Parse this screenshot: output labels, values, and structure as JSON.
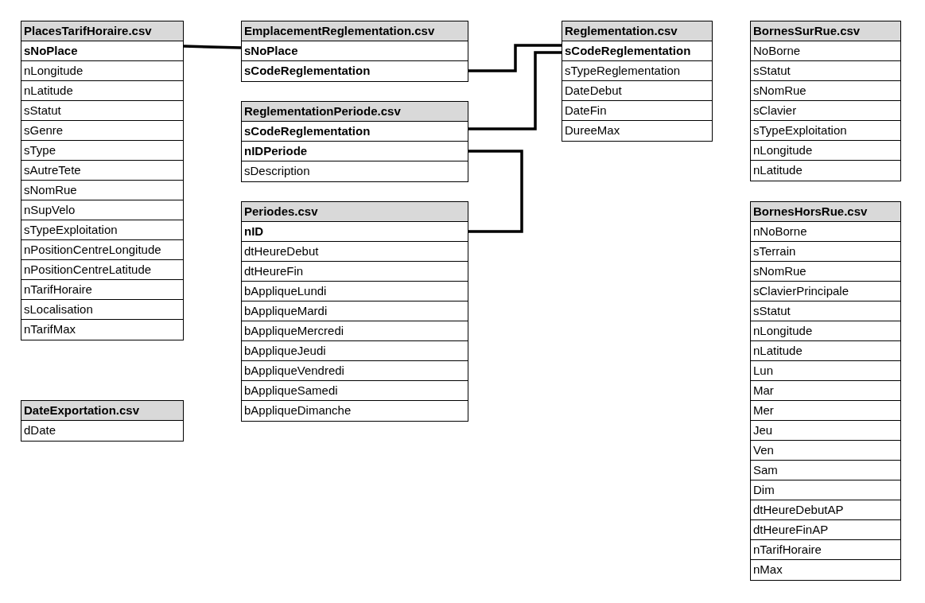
{
  "columns": [
    {
      "tables": [
        {
          "title": "PlacesTarifHoraire.csv",
          "fields": [
            {
              "name": "sNoPlace",
              "key": true
            },
            {
              "name": "nLongitude",
              "key": false
            },
            {
              "name": "nLatitude",
              "key": false
            },
            {
              "name": "sStatut",
              "key": false
            },
            {
              "name": "sGenre",
              "key": false
            },
            {
              "name": "sType",
              "key": false
            },
            {
              "name": "sAutreTete",
              "key": false
            },
            {
              "name": "sNomRue",
              "key": false
            },
            {
              "name": "nSupVelo",
              "key": false
            },
            {
              "name": "sTypeExploitation",
              "key": false
            },
            {
              "name": "nPositionCentreLongitude",
              "key": false
            },
            {
              "name": "nPositionCentreLatitude",
              "key": false
            },
            {
              "name": "nTarifHoraire",
              "key": false
            },
            {
              "name": "sLocalisation",
              "key": false
            },
            {
              "name": "nTarifMax",
              "key": false
            }
          ]
        },
        {
          "title": "DateExportation.csv",
          "fields": [
            {
              "name": "dDate",
              "key": false
            }
          ]
        }
      ]
    },
    {
      "tables": [
        {
          "title": "EmplacementReglementation.csv",
          "fields": [
            {
              "name": "sNoPlace",
              "key": true
            },
            {
              "name": "sCodeReglementation",
              "key": true
            }
          ]
        },
        {
          "title": "ReglementationPeriode.csv",
          "fields": [
            {
              "name": "sCodeReglementation",
              "key": true
            },
            {
              "name": "nIDPeriode",
              "key": true
            },
            {
              "name": "sDescription",
              "key": false
            }
          ]
        },
        {
          "title": "Periodes.csv",
          "fields": [
            {
              "name": "nID",
              "key": true
            },
            {
              "name": "dtHeureDebut",
              "key": false
            },
            {
              "name": "dtHeureFin",
              "key": false
            },
            {
              "name": "bAppliqueLundi",
              "key": false
            },
            {
              "name": "bAppliqueMardi",
              "key": false
            },
            {
              "name": "bAppliqueMercredi",
              "key": false
            },
            {
              "name": "bAppliqueJeudi",
              "key": false
            },
            {
              "name": "bAppliqueVendredi",
              "key": false
            },
            {
              "name": "bAppliqueSamedi",
              "key": false
            },
            {
              "name": "bAppliqueDimanche",
              "key": false
            }
          ]
        }
      ]
    },
    {
      "tables": [
        {
          "title": "Reglementation.csv",
          "fields": [
            {
              "name": "sCodeReglementation",
              "key": true
            },
            {
              "name": "sTypeReglementation",
              "key": false
            },
            {
              "name": "DateDebut",
              "key": false
            },
            {
              "name": "DateFin",
              "key": false
            },
            {
              "name": "DureeMax",
              "key": false
            }
          ]
        }
      ]
    },
    {
      "tables": [
        {
          "title": "BornesSurRue.csv",
          "fields": [
            {
              "name": "NoBorne",
              "key": false
            },
            {
              "name": "sStatut",
              "key": false
            },
            {
              "name": "sNomRue",
              "key": false
            },
            {
              "name": "sClavier",
              "key": false
            },
            {
              "name": "sTypeExploitation",
              "key": false
            },
            {
              "name": "nLongitude",
              "key": false
            },
            {
              "name": "nLatitude",
              "key": false
            }
          ]
        },
        {
          "title": "BornesHorsRue.csv",
          "fields": [
            {
              "name": "nNoBorne",
              "key": false
            },
            {
              "name": "sTerrain",
              "key": false
            },
            {
              "name": "sNomRue",
              "key": false
            },
            {
              "name": "sClavierPrincipale",
              "key": false
            },
            {
              "name": "sStatut",
              "key": false
            },
            {
              "name": "nLongitude",
              "key": false
            },
            {
              "name": "nLatitude",
              "key": false
            },
            {
              "name": "Lun",
              "key": false
            },
            {
              "name": "Mar",
              "key": false
            },
            {
              "name": "Mer",
              "key": false
            },
            {
              "name": "Jeu",
              "key": false
            },
            {
              "name": "Ven",
              "key": false
            },
            {
              "name": "Sam",
              "key": false
            },
            {
              "name": "Dim",
              "key": false
            },
            {
              "name": "dtHeureDebutAP",
              "key": false
            },
            {
              "name": "dtHeureFinAP",
              "key": false
            },
            {
              "name": "nTarifHoraire",
              "key": false
            },
            {
              "name": "nMax",
              "key": false
            }
          ]
        }
      ]
    }
  ]
}
